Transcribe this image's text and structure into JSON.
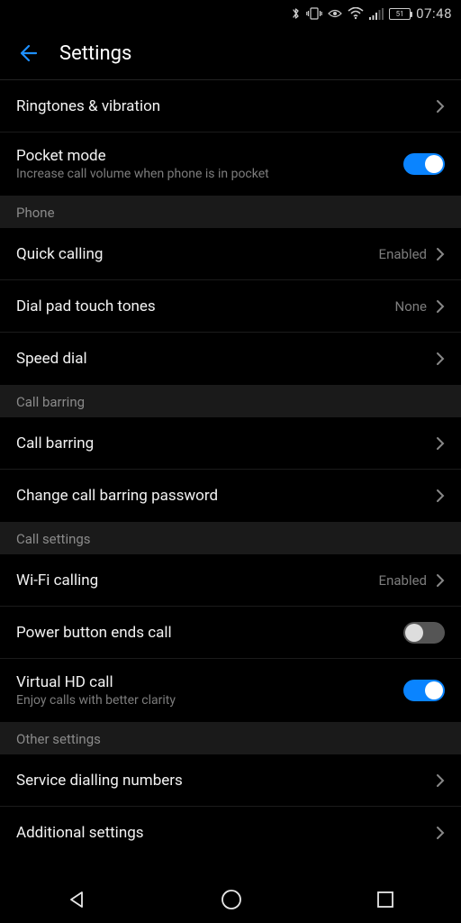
{
  "status": {
    "battery": "51",
    "time": "07:48"
  },
  "header": {
    "title": "Settings"
  },
  "rows": {
    "ringtones": {
      "label": "Ringtones & vibration"
    },
    "pocket": {
      "label": "Pocket mode",
      "sub": "Increase call volume when phone is in pocket",
      "on": true
    },
    "quick": {
      "label": "Quick calling",
      "value": "Enabled"
    },
    "dialpad": {
      "label": "Dial pad touch tones",
      "value": "None"
    },
    "speed": {
      "label": "Speed dial"
    },
    "barring": {
      "label": "Call barring"
    },
    "barringpw": {
      "label": "Change call barring password"
    },
    "wifi": {
      "label": "Wi-Fi calling",
      "value": "Enabled"
    },
    "power": {
      "label": "Power button ends call",
      "on": false
    },
    "hd": {
      "label": "Virtual HD call",
      "sub": "Enjoy calls with better clarity",
      "on": true
    },
    "service": {
      "label": "Service dialling numbers"
    },
    "additional": {
      "label": "Additional settings"
    }
  },
  "sections": {
    "phone": "Phone",
    "barring": "Call barring",
    "callset": "Call settings",
    "other": "Other settings"
  }
}
